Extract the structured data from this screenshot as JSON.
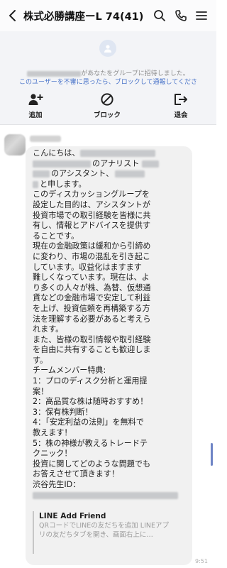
{
  "header": {
    "title": "株式必勝講座ーL 74(41)",
    "back_icon": "chevron-left-icon",
    "search_icon": "search-icon",
    "call_icon": "phone-icon",
    "menu_icon": "menu-icon"
  },
  "notice": {
    "invited_text": "があなたをグループに招待しました。",
    "report_text": "このユーザーを不審に思ったら、ブロックして通報してくださ",
    "link_color": "#4a74c9"
  },
  "actions": {
    "add_label": "追加",
    "block_label": "ブロック",
    "leave_label": "退会"
  },
  "message": {
    "lines": [
      "こんにちは、",
      "のアナリスト",
      "のアシスタント、",
      "と申します。",
      "このディスカッショングループを",
      "設定した目的は、アシスタントが",
      "投資市場での取引経験を皆様に共",
      "有し、情報とアドバイスを提供す",
      "ることです。",
      "現在の金融政策は緩和から引締め",
      "に変わり、市場の混乱を引き起こ",
      "しています。収益化はますます",
      "難しくなっています。現在は、よ",
      "り多くの人々が株、為替、仮想通",
      "貨などの金融市場で安定して利益",
      "を上げ、投資信頼を再構築する方",
      "法を理解する必要があると考えら",
      "れます。",
      "また、皆様の取引情報や取引経験",
      "を自由に共有することも歓迎しま",
      "す。",
      "チームメンバー特典:",
      "1：プロのディスク分析と運用提",
      "案！",
      "2：高品質な株は随時おすすめ！",
      "3：保有株判断！",
      "4：「安定利益の法則」を無料で",
      "教えます！",
      "5：株の神様が教えるトレードテ",
      "クニック！",
      "投資に関してどのような問題でも",
      "お答えさせて頂きます！",
      "渋谷先生ID："
    ],
    "time": "9:51"
  },
  "link_preview": {
    "title": "LINE Add Friend",
    "desc_line1": "QRコードでLINEの友だちを追加 LINEアプ",
    "desc_line2": "リの友だちタブを開き、画面右上に…"
  }
}
